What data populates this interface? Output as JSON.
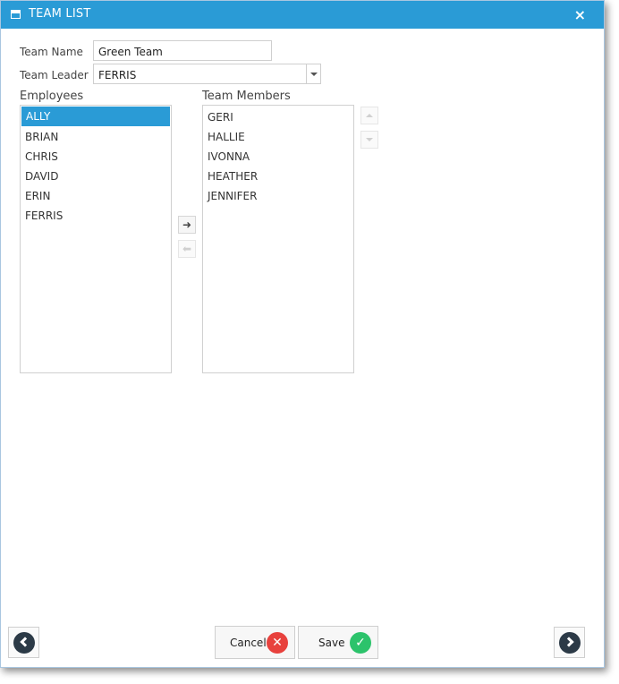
{
  "window": {
    "title": "TEAM LIST",
    "close_label": "×"
  },
  "form": {
    "team_name_label": "Team Name",
    "team_name_value": "Green Team",
    "team_leader_label": "Team Leader",
    "team_leader_value": "FERRIS"
  },
  "employees": {
    "header": "Employees",
    "items": [
      "ALLY",
      "BRIAN",
      "CHRIS",
      "DAVID",
      "ERIN",
      "FERRIS"
    ],
    "selected": "ALLY"
  },
  "team_members": {
    "header": "Team Members",
    "items": [
      "GERI",
      "HALLIE",
      "IVONNA",
      "HEATHER",
      "JENNIFER"
    ]
  },
  "transfer": {
    "add_glyph": "➜",
    "remove_glyph": "⬅"
  },
  "footer": {
    "cancel_label": "Cancel",
    "save_label": "Save"
  },
  "colors": {
    "accent": "#2a9bd6",
    "cancel": "#e8413d",
    "save": "#2cc36b",
    "nav": "#2c3a47"
  }
}
